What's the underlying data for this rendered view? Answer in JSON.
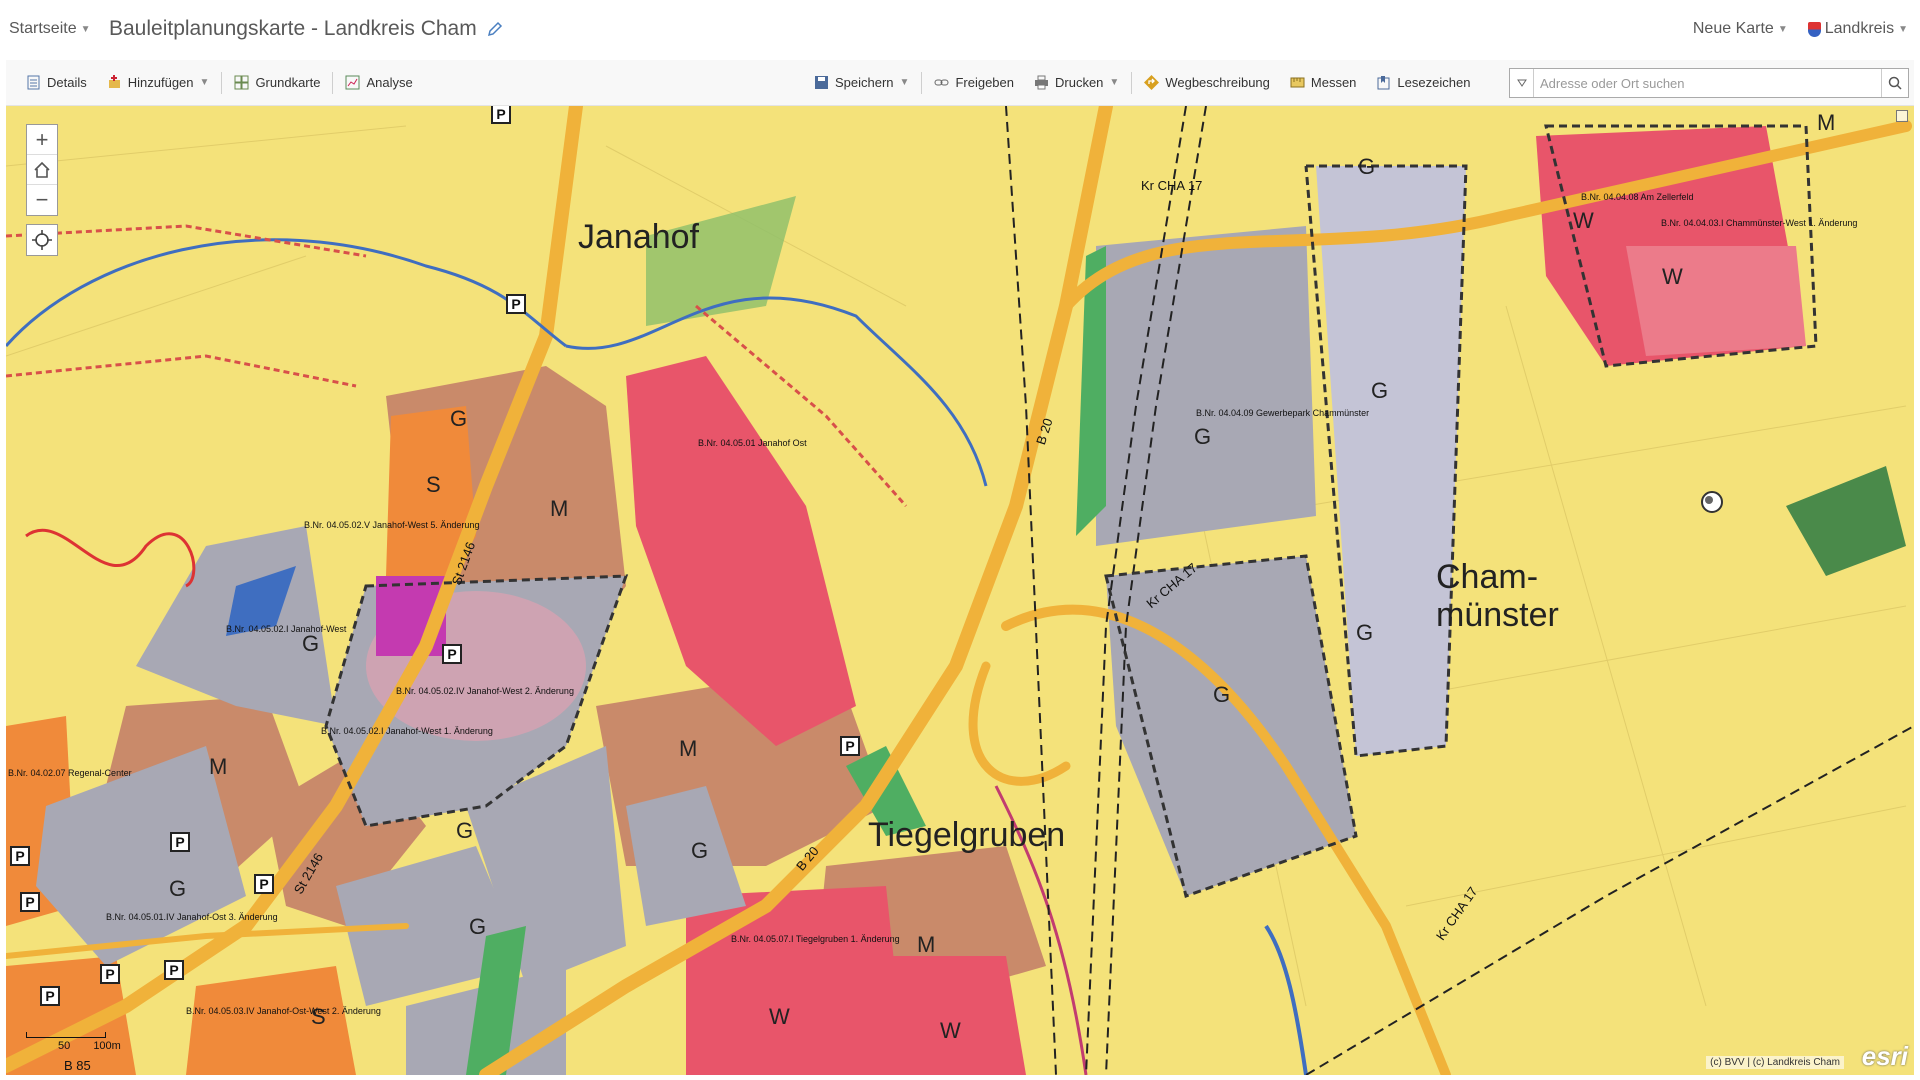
{
  "header": {
    "home_label": "Startseite",
    "map_title": "Bauleitplanungskarte - Landkreis Cham",
    "new_map_label": "Neue Karte",
    "org_label": "Landkreis"
  },
  "toolbar": {
    "details": "Details",
    "add": "Hinzufügen",
    "basemap": "Grundkarte",
    "analysis": "Analyse",
    "save": "Speichern",
    "share": "Freigeben",
    "print": "Drucken",
    "directions": "Wegbeschreibung",
    "measure": "Messen",
    "bookmarks": "Lesezeichen",
    "search_placeholder": "Adresse oder Ort suchen"
  },
  "map": {
    "places": {
      "janahof": "Janahof",
      "chammuenster_1": "Cham-",
      "chammuenster_2": "münster",
      "tiegelgruben": "Tiegelgruben"
    },
    "zones": {
      "g": "G",
      "m": "M",
      "w": "W",
      "s": "S"
    },
    "parcels": {
      "p1": "B.Nr. 04.05.02.I Janahof-West",
      "p2": "B.Nr. 04.05.02.IV Janahof-West 2. Änderung",
      "p3": "B.Nr. 04.05.02.I Janahof-West 1. Änderung",
      "p4": "B.Nr. 04.04.09 Gewerbepark Chammünster",
      "p5": "B.Nr. 04.04.08 Am Zellerfeld",
      "p6": "B.Nr. 04.04.03.I Chammünster-West 1. Änderung",
      "p7": "B.Nr. 04.05.07.I Tiegelgruben 1. Änderung",
      "p8": "B.Nr. 04.05.03.IV Janahof-Ost-West 2. Änderung",
      "p9": "B.Nr. 04.05.01.IV Janahof-Ost 3. Änderung",
      "p10": "B.Nr. 04.05.02.V Janahof-West 5. Änderung",
      "p11": "B.Nr. 04.02.07 Regenal-Center",
      "p12": "B.Nr. 04.05.01 Janahof Ost"
    },
    "roads": {
      "st2146": "St 2146",
      "b20": "B 20",
      "kr_cha17": "Kr CHA 17",
      "b85": "B 85"
    },
    "controls": {
      "zoom_in": "+",
      "zoom_out": "−"
    },
    "scale": {
      "s50": "50",
      "s100": "100m"
    },
    "attribution": "(c) BVV | (c) Landkreis Cham",
    "logo": "esri"
  },
  "colors": {
    "yellow": "#f4e27a",
    "gray": "#a8a8b4",
    "brown": "#c98a6a",
    "red": "#e8556a",
    "orange": "#f08a3a",
    "green": "#4fae62",
    "road": "#f0b23a"
  }
}
